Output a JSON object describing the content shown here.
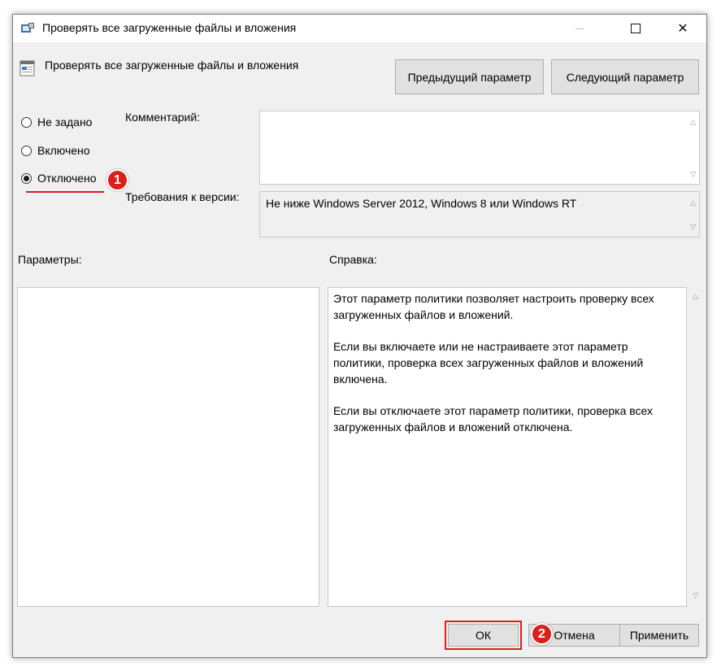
{
  "window": {
    "title": "Проверять все загруженные файлы и вложения"
  },
  "header": {
    "policy_name": "Проверять все загруженные файлы и вложения",
    "prev_button": "Предыдущий параметр",
    "next_button": "Следующий параметр"
  },
  "state": {
    "options": [
      {
        "label": "Не задано",
        "checked": false
      },
      {
        "label": "Включено",
        "checked": false
      },
      {
        "label": "Отключено",
        "checked": true
      }
    ]
  },
  "comment": {
    "label": "Комментарий:",
    "value": ""
  },
  "version": {
    "label": "Требования к версии:",
    "value": "Не ниже Windows Server 2012, Windows 8 или Windows RT"
  },
  "params": {
    "label": "Параметры:"
  },
  "help": {
    "label": "Справка:",
    "paragraphs": [
      "Этот параметр политики позволяет настроить проверку всех загруженных файлов и вложений.",
      "Если вы включаете или не настраиваете этот параметр политики, проверка всех загруженных файлов и вложений включена.",
      "Если вы отключаете этот параметр политики, проверка всех загруженных файлов и вложений отключена."
    ]
  },
  "footer": {
    "ok": "ОК",
    "cancel": "Отмена",
    "apply": "Применить"
  },
  "annotations": {
    "marker1": "1",
    "marker2": "2",
    "color": "#d9201d"
  }
}
